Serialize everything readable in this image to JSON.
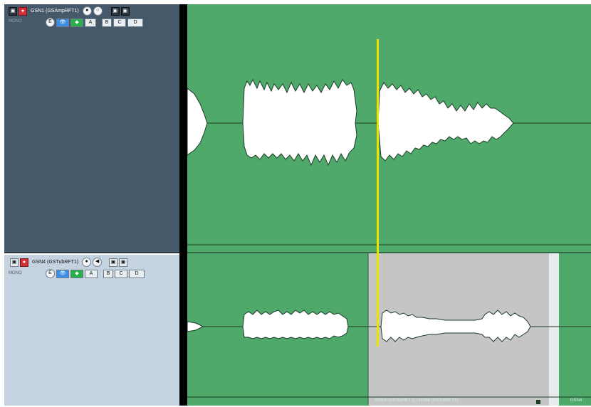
{
  "track1": {
    "name": "GSN1 (GSAmpRFT1)",
    "mode": "MONO"
  },
  "track2": {
    "name": "GSN4 (GSTubRFT1)",
    "mode": "MONO"
  },
  "buttons": {
    "edit": "E",
    "monitor": "M",
    "a": "A",
    "b": "B",
    "c": "C",
    "d": "D",
    "e": "E",
    "r": "R",
    "s": "S",
    "wave": "~"
  },
  "clip_labels": {
    "lower_main": "GSN4 (GSTubRFT1) | GSN4 (GSTubRFT1)",
    "lower_right": "GSN4"
  },
  "colors": {
    "lane_bg": "#4fa96a",
    "cursor": "#f0e200",
    "selection": "#c5c5c5"
  }
}
